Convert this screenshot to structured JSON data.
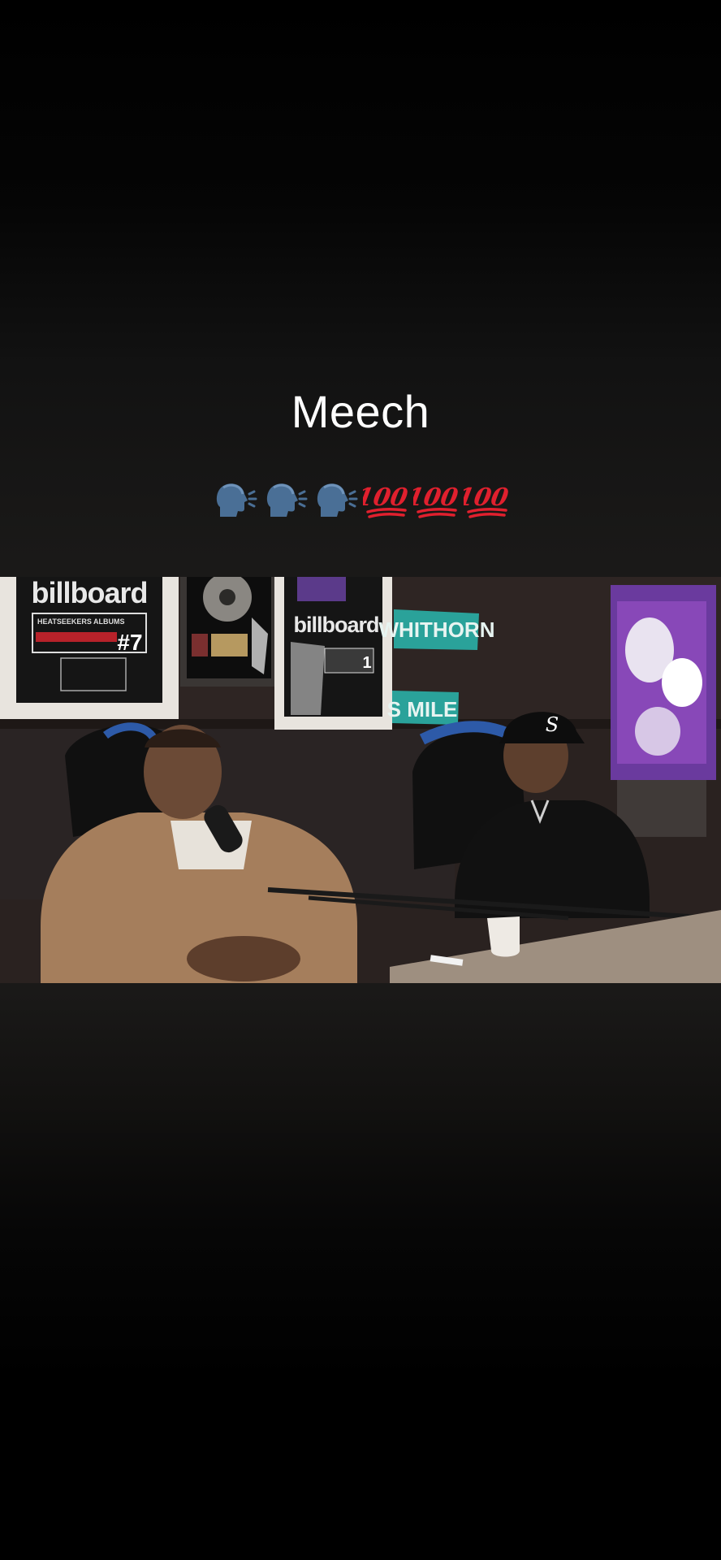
{
  "caption": {
    "title": "Meech",
    "emojis": [
      "speaking-head",
      "speaking-head",
      "speaking-head",
      "hundred-points",
      "hundred-points",
      "hundred-points"
    ]
  },
  "video": {
    "description_icon": "podcast-video-frame",
    "wall_plaques": [
      {
        "brand": "billboard",
        "chart": "HEATSEEKERS ALBUMS",
        "rank": "#7"
      },
      {
        "brand": "billboard",
        "rank": "1"
      }
    ],
    "street_signs": [
      "WHITHORN",
      "S MILE"
    ]
  },
  "colors": {
    "background": "#000000",
    "caption_text": "#ffffff",
    "hundred_red": "#e0202e",
    "sign_teal": "#2aa29a"
  }
}
